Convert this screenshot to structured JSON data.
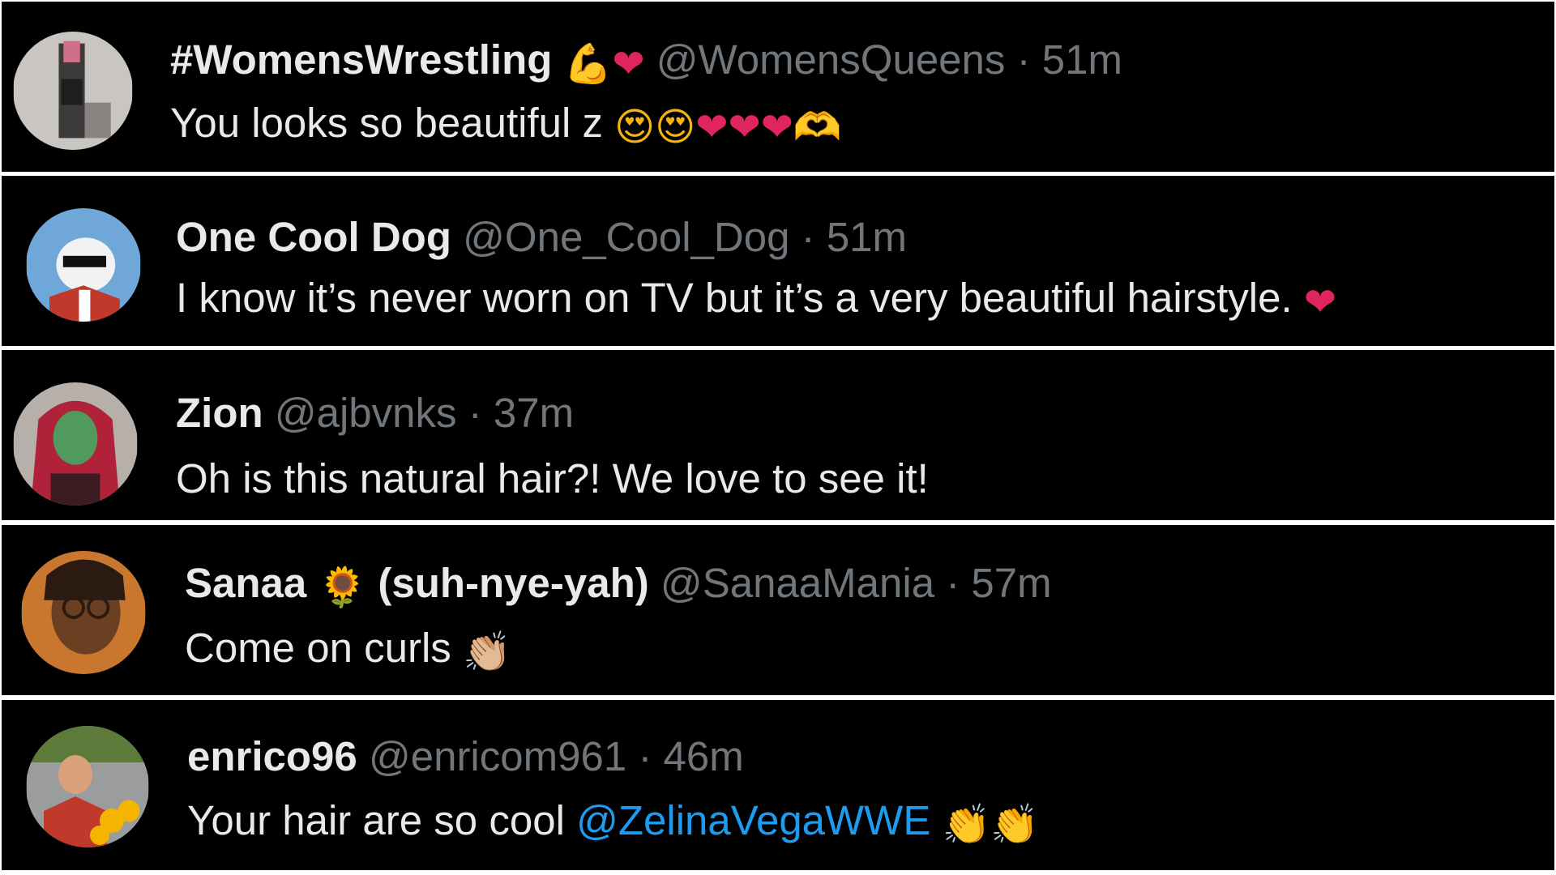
{
  "replies": [
    {
      "display_name": "#WomensWrestling",
      "name_emojis": [
        "💪",
        "❤"
      ],
      "handle": "@WomensQueens",
      "separator": "·",
      "time": "51m",
      "text": "You looks so beautiful z",
      "text_emojis": [
        "😍",
        "😍",
        "❤",
        "❤",
        "❤",
        "🫶"
      ],
      "avatar_icon": "wrestler-avatar"
    },
    {
      "display_name": "One Cool Dog",
      "handle": "@One_Cool_Dog",
      "separator": "·",
      "time": "51m",
      "text": "I know it’s never worn on TV but it’s a very beautiful hairstyle.",
      "text_emojis": [
        "❤"
      ],
      "avatar_icon": "cartoon-dog-avatar"
    },
    {
      "display_name": "Zion",
      "handle": "@ajbvnks",
      "separator": "·",
      "time": "37m",
      "text": "Oh is this natural hair?! We love to see it!",
      "avatar_icon": "green-face-avatar"
    },
    {
      "display_name_before": "Sanaa",
      "name_emoji": "🌻",
      "display_name_after": "(suh-nye-yah)",
      "handle": "@SanaaMania",
      "separator": "·",
      "time": "57m",
      "text": "Come on curls",
      "text_emojis": [
        "👏🏼"
      ],
      "avatar_icon": "woman-glasses-avatar"
    },
    {
      "display_name": "enrico96",
      "handle": "@enricom961",
      "separator": "·",
      "time": "46m",
      "text": "Your hair are so cool",
      "mention": "@ZelinaVegaWWE",
      "text_emojis": [
        "👏",
        "👏"
      ],
      "avatar_icon": "man-sunflowers-avatar"
    }
  ],
  "colors": {
    "background": "#000000",
    "divider": "#ffffff",
    "name": "#e7e9ea",
    "muted": "#71767b",
    "mention": "#1d9bf0",
    "heart": "#e0245e"
  }
}
